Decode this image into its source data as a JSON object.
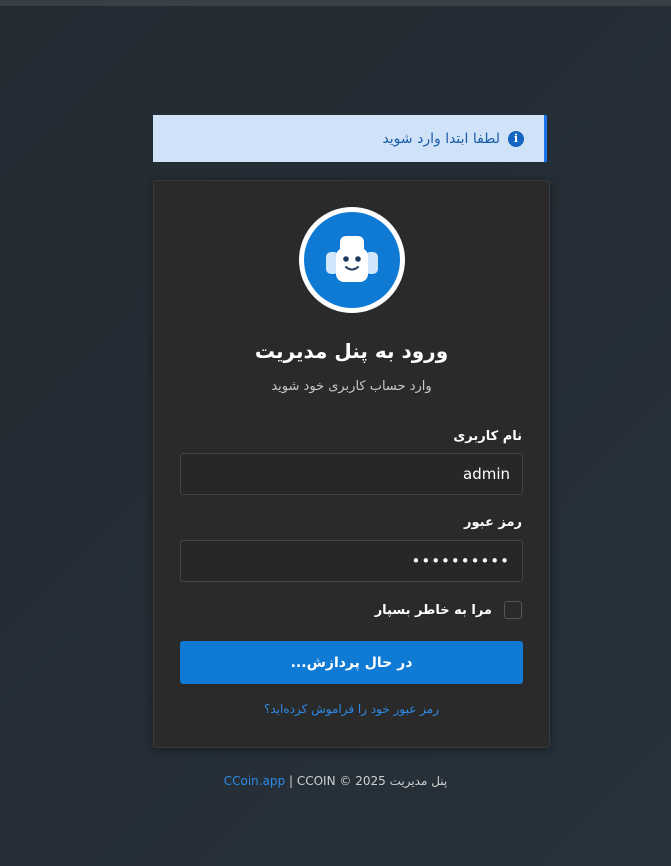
{
  "alert": {
    "text": "لطفا ابتدا وارد شوید",
    "icon": "info-icon"
  },
  "header": {
    "title": "ورود به پنل مدیریت",
    "subtitle": "وارد حساب کاربری خود شوید",
    "logo_icon": "robot-icon"
  },
  "form": {
    "username_label": "نام کاربری",
    "username_value": "admin",
    "password_label": "رمز عبور",
    "password_value": "••••••••••",
    "remember_label": "مرا به خاطر بسپار",
    "remember_checked": false,
    "submit_label": "در حال پردازش...",
    "forgot_link": "رمز عبور خود را فراموش کرده‌اید؟"
  },
  "footer": {
    "prefix": "پنل مدیریت",
    "brand": "CCoin.app",
    "suffix": "| CCOIN © 2025"
  },
  "colors": {
    "accent": "#0e7ad4",
    "alert_bg": "#cfe2f7",
    "card_bg": "#2a2a2a",
    "page_bg": "#252e36"
  }
}
